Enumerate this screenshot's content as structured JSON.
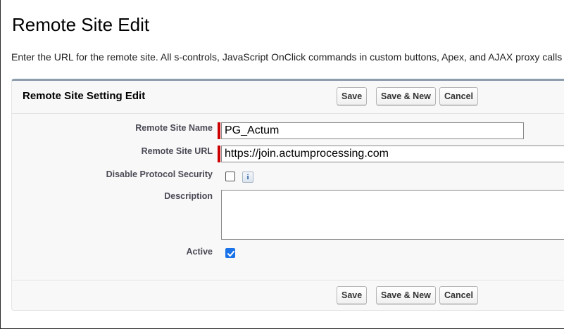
{
  "page": {
    "title": "Remote Site Edit",
    "intro": "Enter the URL for the remote site. All s-controls, JavaScript OnClick commands in custom buttons, Apex, and AJAX proxy calls can access this web address from the user's browser."
  },
  "panel": {
    "title": "Remote Site Setting Edit",
    "buttons": {
      "save": "Save",
      "save_new": "Save & New",
      "cancel": "Cancel"
    }
  },
  "form": {
    "name": {
      "label": "Remote Site Name",
      "value": "PG_Actum",
      "required": true
    },
    "url": {
      "label": "Remote Site URL",
      "value": "https://join.actumprocessing.com",
      "required": true
    },
    "disable_security": {
      "label": "Disable Protocol Security",
      "checked": false,
      "info_icon": "info-icon"
    },
    "description": {
      "label": "Description",
      "value": ""
    },
    "active": {
      "label": "Active",
      "checked": true
    }
  },
  "colors": {
    "required_bar": "#cc0000",
    "checkbox_checked": "#1a73e8",
    "panel_border_top": "#8e9dad"
  }
}
